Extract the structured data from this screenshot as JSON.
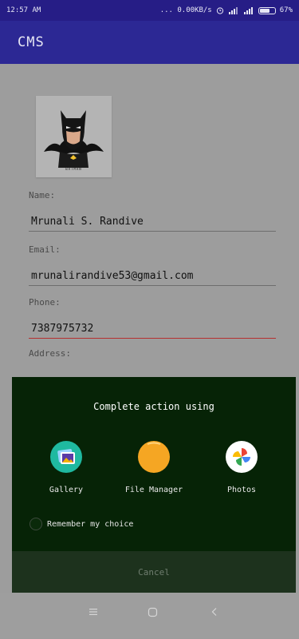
{
  "status_bar": {
    "time": "12:57 AM",
    "right": "... 0.00KB/s",
    "battery_text": "67%",
    "battery_level": 0.67
  },
  "app_bar": {
    "title": "CMS"
  },
  "profile": {
    "avatar_caption": "BATMAN"
  },
  "form": {
    "name_label": "Name:",
    "name_value": "Mrunali S. Randive",
    "email_label": "Email:",
    "email_value": "mrunalirandive53@gmail.com",
    "phone_label": "Phone:",
    "phone_value": "7387975732",
    "address_label": "Address:"
  },
  "chooser": {
    "title": "Complete action using",
    "options": [
      {
        "label": "Gallery",
        "icon": "gallery-icon"
      },
      {
        "label": "File Manager",
        "icon": "file-manager-icon"
      },
      {
        "label": "Photos",
        "icon": "photos-icon"
      }
    ],
    "remember_label": "Remember my choice",
    "cancel_label": "Cancel"
  },
  "colors": {
    "status_bar": "#261d86",
    "app_bar": "#2c2894",
    "dialog_bg": "#062306",
    "active_underline": "#b53030",
    "file_manager_orange": "#f5a623"
  }
}
